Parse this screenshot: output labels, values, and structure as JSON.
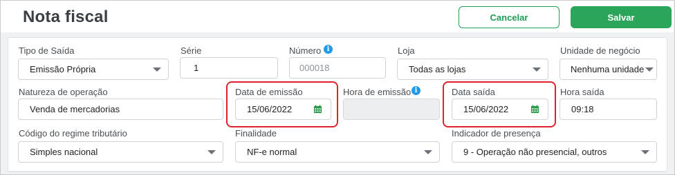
{
  "header": {
    "title": "Nota fiscal",
    "cancel_label": "Cancelar",
    "save_label": "Salvar"
  },
  "colors": {
    "accent": "#2aa55a",
    "highlight": "#e0202b",
    "info": "#1e9be9",
    "calendar_icon": "#2f9a4b"
  },
  "icons": {
    "info": "info-icon",
    "calendar": "calendar-icon",
    "dropdown": "chevron-down-icon"
  },
  "form": {
    "tipo_saida": {
      "label": "Tipo de Saída",
      "value": "Emissão Própria"
    },
    "serie": {
      "label": "Série",
      "value": "1"
    },
    "numero": {
      "label": "Número",
      "placeholder": "000018"
    },
    "loja": {
      "label": "Loja",
      "value": "Todas as lojas"
    },
    "unidade_negocio": {
      "label": "Unidade de negócio",
      "value": "Nenhuma unidade"
    },
    "natureza_operacao": {
      "label": "Natureza de operação",
      "value": "Venda de mercadorias"
    },
    "data_emissao": {
      "label": "Data de emissão",
      "value": "15/06/2022"
    },
    "hora_emissao": {
      "label": "Hora de emissão",
      "value": ""
    },
    "data_saida": {
      "label": "Data saída",
      "value": "15/06/2022"
    },
    "hora_saida": {
      "label": "Hora saída",
      "value": "09:18"
    },
    "regime_tributario": {
      "label": "Código do regime tributário",
      "value": "Simples nacional"
    },
    "finalidade": {
      "label": "Finalidade",
      "value": "NF-e normal"
    },
    "indicador_presenca": {
      "label": "Indicador de presença",
      "value": "9 - Operação não presencial, outros"
    }
  }
}
